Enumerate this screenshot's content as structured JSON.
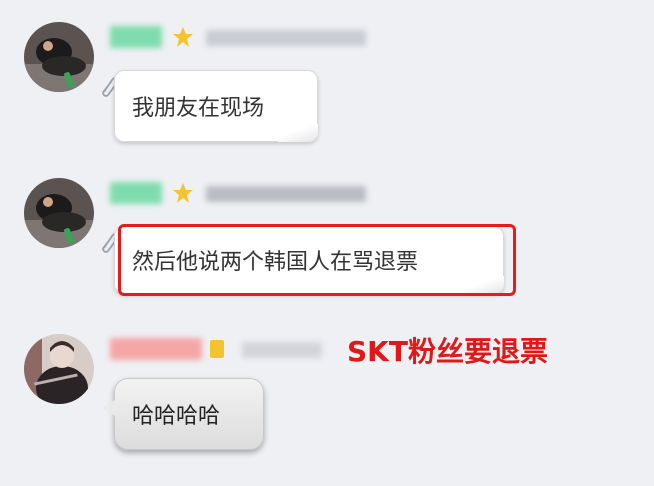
{
  "messages": [
    {
      "text": "我朋友在现场",
      "avatar_icon": "avatar-person-sleeping-on-table",
      "badge_icon": "star-badge-icon",
      "bubble_style": "paper-note"
    },
    {
      "text": "然后他说两个韩国人在骂退票",
      "avatar_icon": "avatar-person-sleeping-on-table",
      "badge_icon": "star-badge-icon",
      "bubble_style": "paper-note",
      "highlighted": true
    },
    {
      "text": "哈哈哈哈",
      "avatar_icon": "avatar-person-in-dark-coat",
      "badge_icon": "vip-badge-icon",
      "bubble_style": "gray-speech"
    }
  ],
  "annotation": {
    "text": "SKT粉丝要退票",
    "color": "#e01818"
  },
  "colors": {
    "background": "#eef0f4",
    "highlight_border": "#e81b1b",
    "name_tag_green": "#6fd9a5",
    "name_tag_pink": "#f5a6a6",
    "star_yellow": "#f4c430"
  }
}
